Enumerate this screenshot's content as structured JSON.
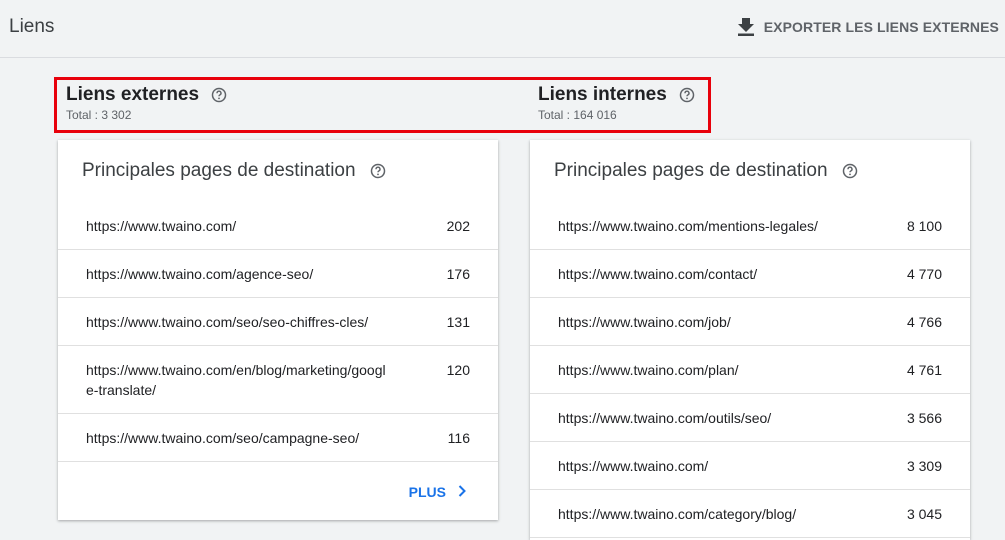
{
  "header": {
    "title": "Liens",
    "export_label": "EXPORTER LES LIENS EXTERNES"
  },
  "external": {
    "title": "Liens externes",
    "total": "Total : 3 302"
  },
  "internal": {
    "title": "Liens internes",
    "total": "Total : 164 016"
  },
  "left_card": {
    "title": "Principales pages de destination",
    "rows": [
      {
        "url": "https://www.twaino.com/",
        "value": "202"
      },
      {
        "url": "https://www.twaino.com/agence-seo/",
        "value": "176"
      },
      {
        "url": "https://www.twaino.com/seo/seo-chiffres-cles/",
        "value": "131"
      },
      {
        "url": "https://www.twaino.com/en/blog/marketing/google-translate/",
        "value": "120"
      },
      {
        "url": "https://www.twaino.com/seo/campagne-seo/",
        "value": "116"
      }
    ],
    "more_label": "PLUS"
  },
  "right_card": {
    "title": "Principales pages de destination",
    "rows": [
      {
        "url": "https://www.twaino.com/mentions-legales/",
        "value": "8 100"
      },
      {
        "url": "https://www.twaino.com/contact/",
        "value": "4 770"
      },
      {
        "url": "https://www.twaino.com/job/",
        "value": "4 766"
      },
      {
        "url": "https://www.twaino.com/plan/",
        "value": "4 761"
      },
      {
        "url": "https://www.twaino.com/outils/seo/",
        "value": "3 566"
      },
      {
        "url": "https://www.twaino.com/",
        "value": "3 309"
      },
      {
        "url": "https://www.twaino.com/category/blog/",
        "value": "3 045"
      }
    ]
  },
  "colors": {
    "accent": "#1a73e8",
    "highlight": "#e8000b",
    "background": "#f1f3f4"
  },
  "icons": {
    "export": "download-icon",
    "help": "help-circle-icon",
    "more": "chevron-right-icon"
  }
}
